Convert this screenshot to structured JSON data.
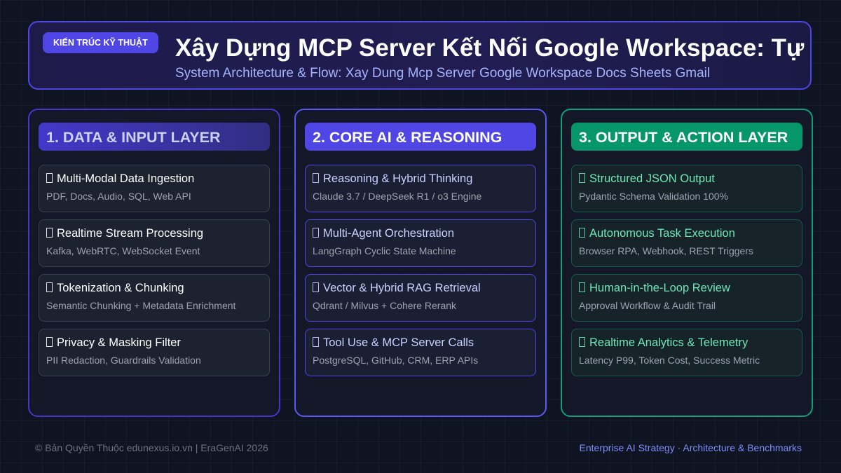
{
  "header": {
    "badge": "KIẾN TRÚC KỸ THUẬT",
    "title": "Xây Dựng MCP Server Kết Nối Google Workspace: Tự Động Hóa Docs, Sheets & Gmail",
    "subtitle": "System Architecture & Flow: Xay Dung Mcp Server Google Workspace Docs Sheets Gmail"
  },
  "columns": [
    {
      "title": "1. DATA & INPUT LAYER",
      "cards": [
        {
          "title": "Multi-Modal Data Ingestion",
          "desc": "PDF, Docs, Audio, SQL, Web API"
        },
        {
          "title": "Realtime Stream Processing",
          "desc": "Kafka, WebRTC, WebSocket Event"
        },
        {
          "title": "Tokenization & Chunking",
          "desc": "Semantic Chunking + Metadata Enrichment"
        },
        {
          "title": "Privacy & Masking Filter",
          "desc": "PII Redaction, Guardrails Validation"
        }
      ]
    },
    {
      "title": "2. CORE AI & REASONING",
      "cards": [
        {
          "title": "Reasoning & Hybrid Thinking",
          "desc": "Claude 3.7 / DeepSeek R1 / o3 Engine"
        },
        {
          "title": "Multi-Agent Orchestration",
          "desc": "LangGraph Cyclic State Machine"
        },
        {
          "title": "Vector & Hybrid RAG Retrieval",
          "desc": "Qdrant / Milvus + Cohere Rerank"
        },
        {
          "title": "Tool Use & MCP Server Calls",
          "desc": "PostgreSQL, GitHub, CRM, ERP APIs"
        }
      ]
    },
    {
      "title": "3. OUTPUT & ACTION LAYER",
      "cards": [
        {
          "title": "Structured JSON Output",
          "desc": "Pydantic Schema Validation 100%"
        },
        {
          "title": "Autonomous Task Execution",
          "desc": "Browser RPA, Webhook, REST Triggers"
        },
        {
          "title": "Human-in-the-Loop Review",
          "desc": "Approval Workflow & Audit Trail"
        },
        {
          "title": "Realtime Analytics & Telemetry",
          "desc": "Latency P99, Token Cost, Success Metric"
        }
      ]
    }
  ],
  "footer": {
    "copyright": "© Bản Quyền Thuộc edunexus.io.vn | EraGenAI 2026",
    "tagline": "Enterprise AI Strategy · Architecture & Benchmarks"
  },
  "colors": {
    "background": "#0f1422",
    "accent_indigo": "#4f46e5",
    "accent_green": "#059669",
    "subtitle": "#a5b4fc"
  }
}
